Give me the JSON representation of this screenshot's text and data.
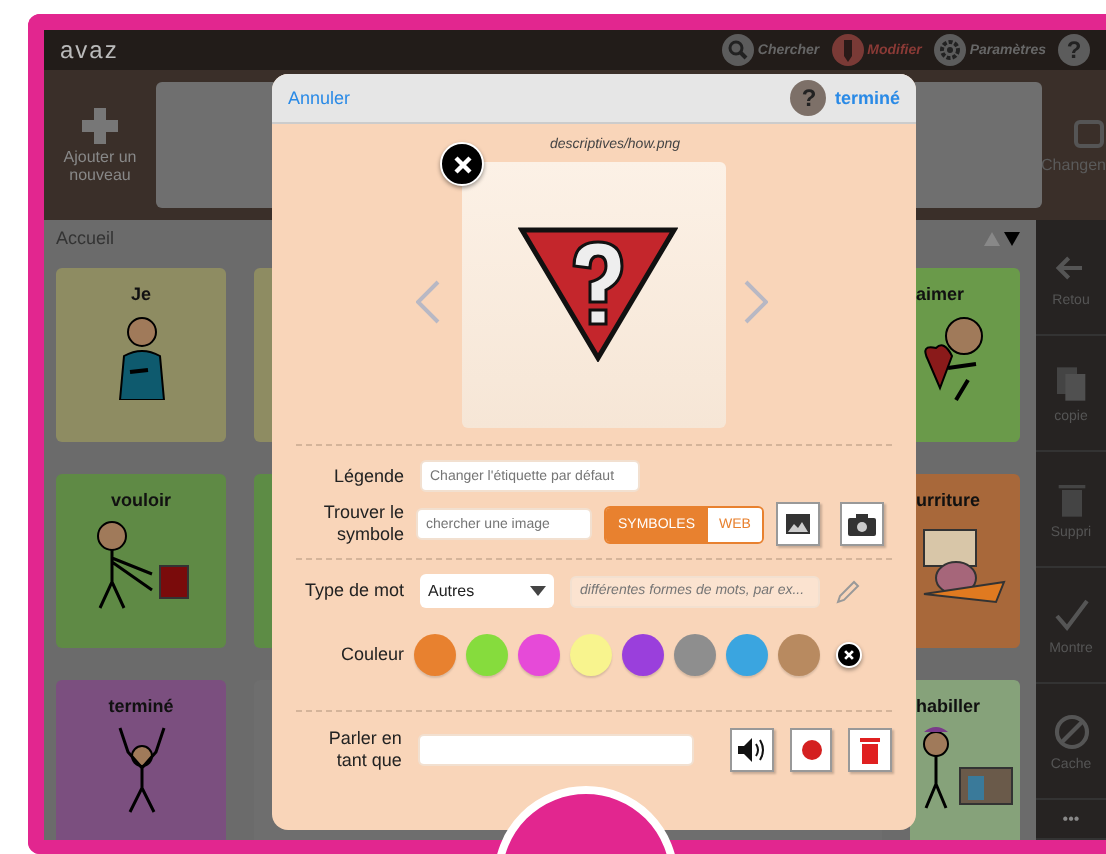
{
  "app": {
    "logo": "avaz"
  },
  "toolbar": [
    {
      "kind": "search",
      "label": "Chercher",
      "selected": false
    },
    {
      "kind": "edit",
      "label": "Modifier",
      "selected": true
    },
    {
      "kind": "settings",
      "label": "Paramètres",
      "selected": false
    },
    {
      "kind": "help",
      "symbol": "?",
      "selected": false
    }
  ],
  "add_button": {
    "label": "Ajouter un nouveau"
  },
  "change_button": {
    "label": "Changen"
  },
  "breadcrumb": "Accueil",
  "tiles_left": [
    {
      "label": "Je",
      "kind": "person",
      "color": "#8e8c62"
    },
    {
      "label": "vouloir",
      "kind": "want",
      "color": "#5f8a45"
    },
    {
      "label": "terminé",
      "kind": "done",
      "color": "#7b4f7f"
    }
  ],
  "tiles_hidden": [
    {
      "color": "#8e8c62"
    },
    {
      "color": "#5d8c45"
    },
    {
      "color": "#6e6e6e"
    }
  ],
  "tiles_right": [
    {
      "label": "aimer",
      "kind": "love",
      "color": "#6a9a4a"
    },
    {
      "label": "urriture",
      "kind": "food",
      "color": "#a8683a"
    },
    {
      "label": "habiller",
      "kind": "clothes",
      "color": "#86a27a"
    }
  ],
  "sidebar": [
    {
      "kind": "back",
      "label": "Retou"
    },
    {
      "kind": "copy",
      "label": "copie"
    },
    {
      "kind": "delete",
      "label": "Suppri"
    },
    {
      "kind": "show",
      "label": "Montre"
    },
    {
      "kind": "hide",
      "label": "Cache"
    },
    {
      "kind": "more",
      "label": "•••"
    }
  ],
  "dialog": {
    "cancel": "Annuler",
    "help_symbol": "?",
    "done": "terminé",
    "file_name": "descriptives/how.png",
    "caption_label": "Légende",
    "caption_placeholder": "Changer l'étiquette par défaut",
    "find_label": "Trouver le symbole",
    "find_placeholder": "chercher une image",
    "sources": [
      {
        "label": "SYMBOLES",
        "selected": true
      },
      {
        "label": "WEB",
        "selected": false
      }
    ],
    "word_type_label": "Type de mot",
    "word_type": "Autres",
    "forms_placeholder": "différentes formes de mots, par ex...",
    "color_label": "Couleur",
    "colors": [
      {
        "color": "#e8812f"
      },
      {
        "color": "#86dc3d"
      },
      {
        "color": "#e64ad8"
      },
      {
        "color": "#f8f48e"
      },
      {
        "color": "#9a3fdc"
      },
      {
        "color": "#8e8e8e"
      },
      {
        "color": "#3aa5e0"
      },
      {
        "color": "#b88a60"
      }
    ],
    "speak_label": "Parler en tant que"
  }
}
